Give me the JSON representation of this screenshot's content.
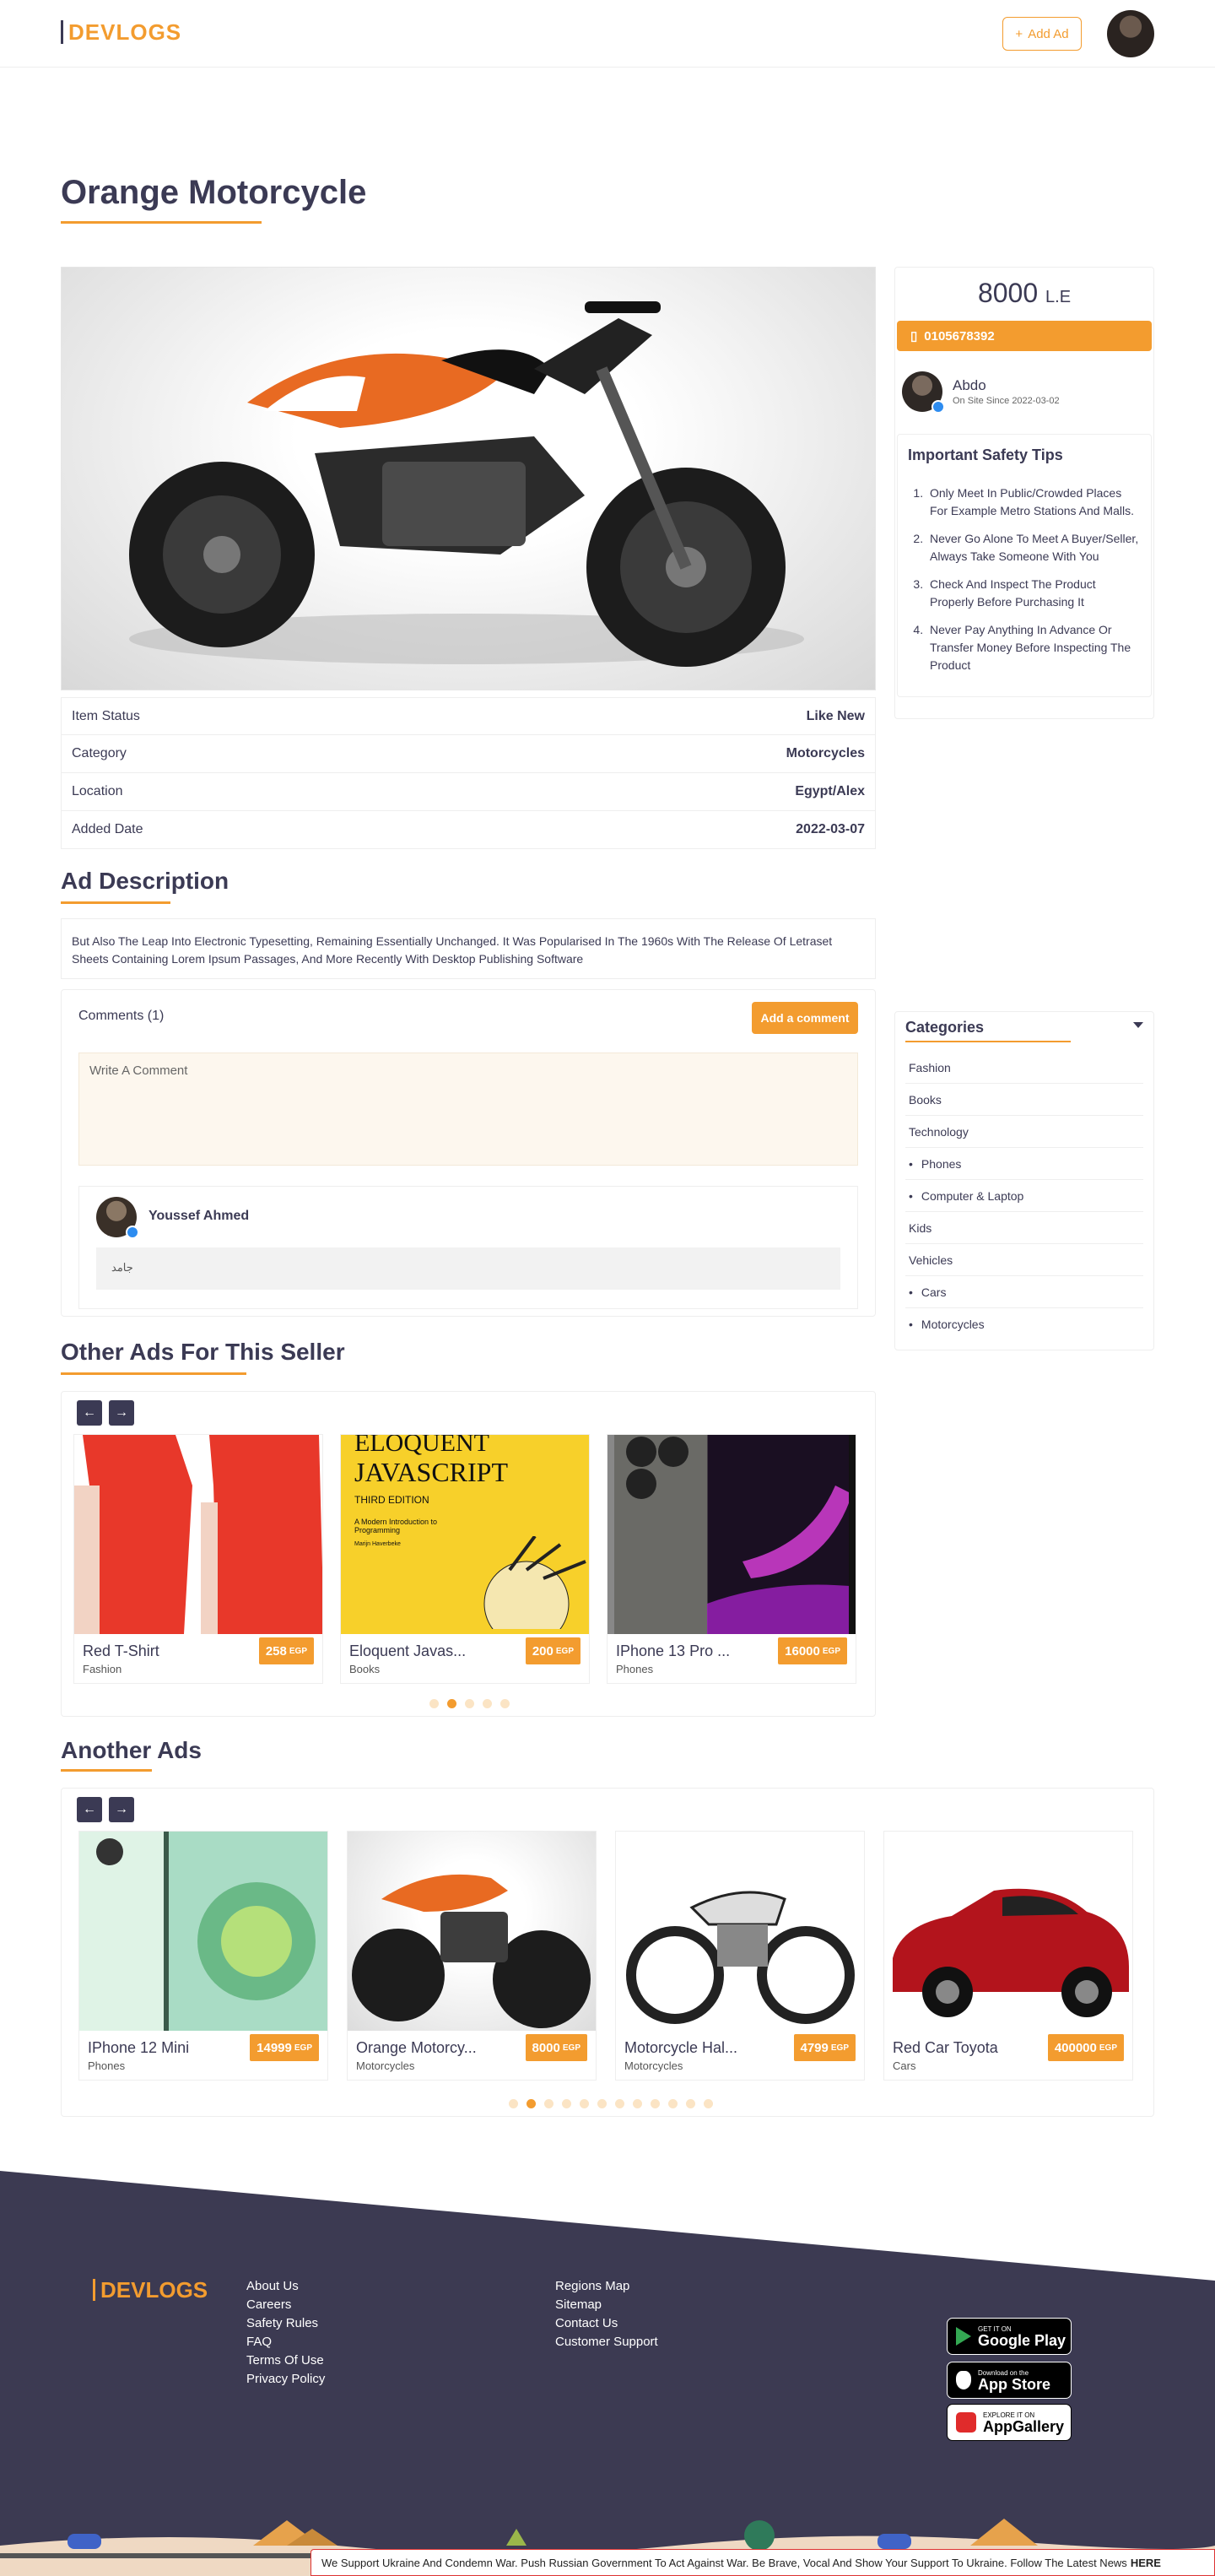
{
  "header": {
    "logo": "DEVLOGS",
    "add_ad_label": "Add Ad"
  },
  "ad": {
    "title": "Orange Motorcycle",
    "price": "8000",
    "currency": "L.E",
    "phone": "0105678392",
    "info": [
      {
        "label": "Item Status",
        "value": "Like New"
      },
      {
        "label": "Category",
        "value": "Motorcycles"
      },
      {
        "label": "Location",
        "value": "Egypt/Alex"
      },
      {
        "label": "Added Date",
        "value": "2022-03-07"
      }
    ],
    "description_heading": "Ad Description",
    "description": "But Also The Leap Into Electronic Typesetting, Remaining Essentially Unchanged. It Was Popularised In The 1960s With The Release Of Letraset Sheets Containing Lorem Ipsum Passages, And More Recently With Desktop Publishing Software"
  },
  "seller": {
    "name": "Abdo",
    "since": "On Site Since 2022-03-02"
  },
  "safety": {
    "title": "Important Safety Tips",
    "tips": [
      "Only Meet In Public/Crowded Places For Example Metro Stations And Malls.",
      "Never Go Alone To Meet A Buyer/Seller, Always Take Someone With You",
      "Check And Inspect The Product Properly Before Purchasing It",
      "Never Pay Anything In Advance Or Transfer Money Before Inspecting The Product"
    ]
  },
  "comments": {
    "title": "Comments (1)",
    "add_label": "Add a comment",
    "placeholder": "Write A Comment",
    "items": [
      {
        "author": "Youssef Ahmed",
        "text": "جامد"
      }
    ]
  },
  "categories": {
    "title": "Categories",
    "items": [
      {
        "label": "Fashion",
        "sub": false
      },
      {
        "label": "Books",
        "sub": false
      },
      {
        "label": "Technology",
        "sub": false
      },
      {
        "label": "Phones",
        "sub": true
      },
      {
        "label": "Computer & Laptop",
        "sub": true
      },
      {
        "label": "Kids",
        "sub": false
      },
      {
        "label": "Vehicles",
        "sub": false
      },
      {
        "label": "Cars",
        "sub": true
      },
      {
        "label": "Motorcycles",
        "sub": true
      }
    ]
  },
  "seller_ads": {
    "title": "Other Ads For This Seller",
    "currency": "EGP",
    "cards": [
      {
        "name": "Red T-Shirt",
        "category": "Fashion",
        "price": "258"
      },
      {
        "name": "Eloquent Javas...",
        "category": "Books",
        "price": "200"
      },
      {
        "name": "IPhone 13 Pro ...",
        "category": "Phones",
        "price": "16000"
      }
    ],
    "book_cover": {
      "title1": "ELOQUENT",
      "title2": "JAVASCRIPT",
      "edition": "THIRD EDITION",
      "subtitle": "A Modern Introduction to Programming",
      "author": "Marijn Haverbeke"
    }
  },
  "another_ads": {
    "title": "Another Ads",
    "currency": "EGP",
    "cards": [
      {
        "name": "IPhone 12 Mini",
        "category": "Phones",
        "price": "14999"
      },
      {
        "name": "Orange Motorcy...",
        "category": "Motorcycles",
        "price": "8000"
      },
      {
        "name": "Motorcycle Hal...",
        "category": "Motorcycles",
        "price": "4799"
      },
      {
        "name": "Red Car Toyota",
        "category": "Cars",
        "price": "400000"
      }
    ]
  },
  "footer": {
    "logo": "DEVLOGS",
    "col1": [
      "About Us",
      "Careers",
      "Safety Rules",
      "FAQ",
      "Terms Of Use",
      "Privacy Policy"
    ],
    "col2": [
      "Regions Map",
      "Sitemap",
      "Contact Us",
      "Customer Support"
    ],
    "stores": [
      {
        "small": "GET IT ON",
        "big": "Google Play"
      },
      {
        "small": "Download on the",
        "big": "App Store"
      },
      {
        "small": "EXPLORE IT ON",
        "big": "AppGallery"
      }
    ],
    "news": "We Support Ukraine And Condemn War. Push Russian Government To Act Against War. Be Brave, Vocal And Show Your Support To Ukraine. Follow The Latest News",
    "news_link": "HERE"
  }
}
